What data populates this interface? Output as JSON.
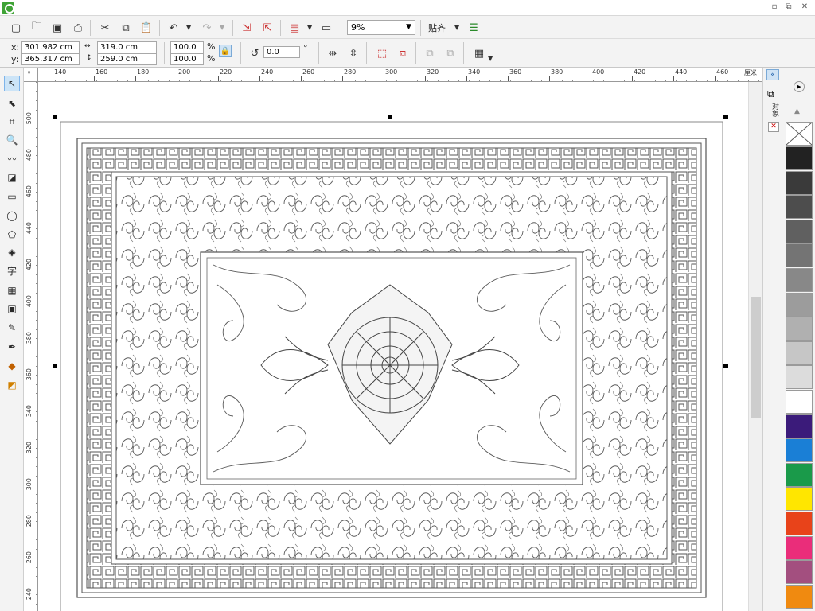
{
  "toolbar": {
    "zoom_value": "9%",
    "snap_label": "贴齐"
  },
  "properties": {
    "x_label": "x:",
    "y_label": "y:",
    "x_value": "301.982 cm",
    "y_value": "365.317 cm",
    "width_value": "319.0 cm",
    "height_value": "259.0 cm",
    "scale_w": "100.0",
    "scale_h": "100.0",
    "percent": "%",
    "rotation_value": "0.0",
    "degree": "°"
  },
  "ruler": {
    "unit": "厘米",
    "top_ticks": [
      "140",
      "160",
      "180",
      "200",
      "220",
      "240",
      "260",
      "280",
      "300",
      "320",
      "340",
      "360",
      "380",
      "400",
      "420",
      "440",
      "460"
    ],
    "left_ticks": [
      "500",
      "480",
      "460",
      "440",
      "420",
      "400",
      "380",
      "360",
      "340",
      "320",
      "300",
      "280",
      "260",
      "240"
    ]
  },
  "docker": {
    "tab_label": "对象"
  },
  "palette": {
    "colors": [
      "#222222",
      "#3a3a3a",
      "#4d4d4d",
      "#606060",
      "#747474",
      "#888888",
      "#9c9c9c",
      "#b0b0b0",
      "#c6c6c6",
      "#dcdcdc",
      "#ffffff",
      "#3b1b7a",
      "#1a7fd6",
      "#1a9a4a",
      "#ffe600",
      "#e8431a",
      "#ea2d7a",
      "#a34f7f",
      "#f08a10"
    ]
  },
  "toolbox": {
    "text_tool_label": "字"
  }
}
